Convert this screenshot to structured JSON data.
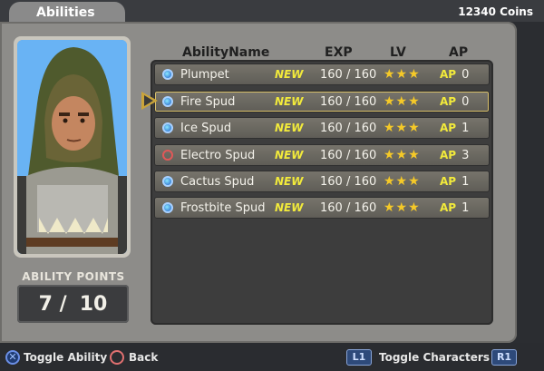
{
  "header": {
    "tab_title": "Abilities",
    "coins": "12340 Coins"
  },
  "columns": {
    "name": "AbilityName",
    "exp": "EXP",
    "lv": "LV",
    "ap": "AP"
  },
  "abilities": [
    {
      "name": "Plumpet",
      "tag": "NEW",
      "exp": "160 / 160",
      "stars": "★★★",
      "ap_label": "AP",
      "ap": "0",
      "enabled": true
    },
    {
      "name": "Fire Spud",
      "tag": "NEW",
      "exp": "160 / 160",
      "stars": "★★★",
      "ap_label": "AP",
      "ap": "0",
      "enabled": true
    },
    {
      "name": "Ice Spud",
      "tag": "NEW",
      "exp": "160 / 160",
      "stars": "★★★",
      "ap_label": "AP",
      "ap": "1",
      "enabled": true
    },
    {
      "name": "Electro Spud",
      "tag": "NEW",
      "exp": "160 / 160",
      "stars": "★★★",
      "ap_label": "AP",
      "ap": "3",
      "enabled": false
    },
    {
      "name": "Cactus Spud",
      "tag": "NEW",
      "exp": "160 / 160",
      "stars": "★★★",
      "ap_label": "AP",
      "ap": "1",
      "enabled": true
    },
    {
      "name": "Frostbite Spud",
      "tag": "NEW",
      "exp": "160 / 160",
      "stars": "★★★",
      "ap_label": "AP",
      "ap": "1",
      "enabled": true
    }
  ],
  "ability_points": {
    "title": "ABILITY POINTS",
    "current": "7 /",
    "max": "10"
  },
  "footer": {
    "x_label": "Toggle Ability",
    "o_label": "Back",
    "l1": "L1",
    "r1": "R1",
    "toggle_chars": "Toggle Characters"
  },
  "icons": {
    "enabled_dot": "blue-orb-icon",
    "disabled_dot": "red-ring-icon",
    "cursor": "arrow-cursor-icon"
  }
}
